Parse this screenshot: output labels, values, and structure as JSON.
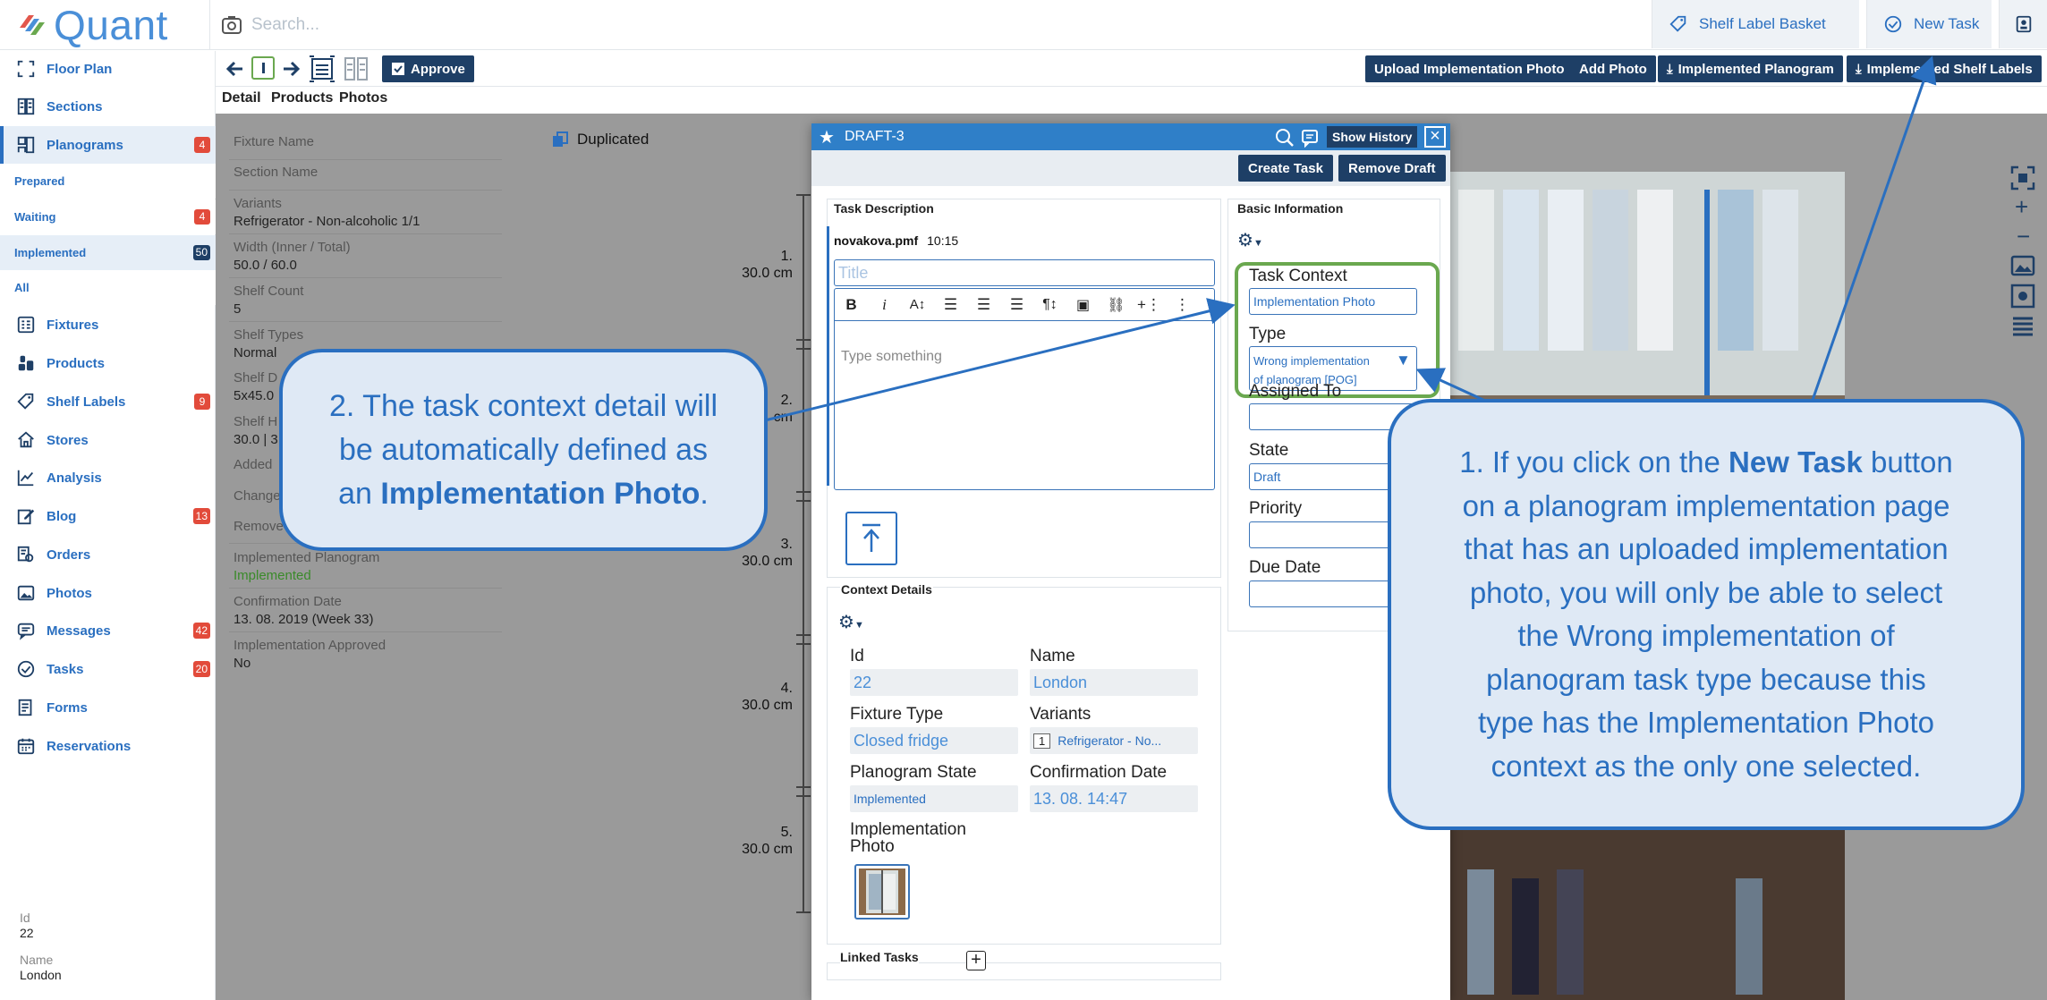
{
  "app": {
    "name": "Quant"
  },
  "search": {
    "placeholder": "Search..."
  },
  "top_buttons": {
    "shelf_label_basket": "Shelf Label Basket",
    "new_task": "New Task"
  },
  "sidebar": {
    "items": [
      {
        "label": "Floor Plan",
        "icon": "floor-plan-icon"
      },
      {
        "label": "Sections",
        "icon": "sections-icon"
      },
      {
        "label": "Planograms",
        "icon": "planograms-icon",
        "badge": "4"
      },
      {
        "label": "Fixtures",
        "icon": "fixtures-icon"
      },
      {
        "label": "Products",
        "icon": "products-icon"
      },
      {
        "label": "Shelf Labels",
        "icon": "tag-icon",
        "badge": "9"
      },
      {
        "label": "Stores",
        "icon": "store-icon"
      },
      {
        "label": "Analysis",
        "icon": "chart-icon"
      },
      {
        "label": "Blog",
        "icon": "edit-icon",
        "badge": "13"
      },
      {
        "label": "Orders",
        "icon": "orders-icon"
      },
      {
        "label": "Photos",
        "icon": "photo-icon"
      },
      {
        "label": "Messages",
        "icon": "message-icon",
        "badge": "42"
      },
      {
        "label": "Tasks",
        "icon": "check-icon",
        "badge": "20"
      },
      {
        "label": "Forms",
        "icon": "forms-icon"
      },
      {
        "label": "Reservations",
        "icon": "calendar-icon"
      }
    ],
    "submenu": [
      {
        "label": "Prepared"
      },
      {
        "label": "Waiting",
        "badge": "4"
      },
      {
        "label": "Implemented",
        "badge": "50"
      },
      {
        "label": "All"
      }
    ],
    "info": {
      "id_label": "Id",
      "id_value": "22",
      "name_label": "Name",
      "name_value": "London"
    }
  },
  "toolbar": {
    "approve": "Approve",
    "upload_photo": "Upload Implementation Photo",
    "add_photo": "Add Photo",
    "implemented_planogram": "Implemented Planogram",
    "implemented_shelf_labels": "Implemented Shelf Labels"
  },
  "tabs": [
    "Detail",
    "Products",
    "Photos"
  ],
  "detail": {
    "fixture_name": "Fixture Name",
    "section_name": "Section Name",
    "variants_label": "Variants",
    "variants_value": "Refrigerator - Non-alcoholic 1/1",
    "width_label": "Width (Inner / Total)",
    "width_value": "50.0 / 60.0",
    "shelf_count_label": "Shelf Count",
    "shelf_count_value": "5",
    "shelf_types_label": "Shelf Types",
    "shelf_types_value": "Normal",
    "shelf_d_label": "Shelf D",
    "shelf_d_value": "5x45.0",
    "shelf_h_label": "Shelf H",
    "shelf_h_value": "30.0 | 3",
    "added_label": "Added",
    "changed_label": "Change",
    "removed_label": "Remove",
    "impl_pog_label": "Implemented Planogram",
    "impl_pog_value": "Implemented",
    "confirmation_label": "Confirmation Date",
    "confirmation_value": "13. 08. 2019 (Week 33)",
    "approved_label": "Implementation Approved",
    "approved_value": "No",
    "duplicated": "Duplicated"
  },
  "shelves": [
    {
      "num": "1.",
      "height": "30.0 cm"
    },
    {
      "num": "2.",
      "height": "cm"
    },
    {
      "num": "3.",
      "height": "30.0 cm"
    },
    {
      "num": "4.",
      "height": "30.0 cm"
    },
    {
      "num": "5.",
      "height": "30.0 cm"
    }
  ],
  "modal": {
    "title": "DRAFT-3",
    "show_history": "Show History",
    "create_task": "Create Task",
    "remove_draft": "Remove Draft",
    "task_description": "Task Description",
    "author": "novakova.pmf",
    "time": "10:15",
    "title_placeholder": "Title",
    "body_placeholder": "Type something",
    "basic_information": "Basic Information",
    "task_context_label": "Task Context",
    "task_context_value": "Implementation Photo",
    "type_label": "Type",
    "type_value_line1": "Wrong implementation",
    "type_value_line2": "of planogram [POG]",
    "assigned_label": "Assigned To",
    "state_label": "State",
    "state_value": "Draft",
    "priority_label": "Priority",
    "due_date_label": "Due Date",
    "context_details": "Context Details",
    "id_label": "Id",
    "id_value": "22",
    "name_label": "Name",
    "name_value": "London",
    "fixture_type_label": "Fixture Type",
    "fixture_type_value": "Closed fridge",
    "variants_label": "Variants",
    "variants_count": "1",
    "variants_value": "Refrigerator - No...",
    "pog_state_label": "Planogram State",
    "pog_state_value": "Implemented",
    "conf_date_label": "Confirmation Date",
    "conf_date_value": "13. 08. 14:47",
    "impl_photo_label_1": "Implementation",
    "impl_photo_label_2": "Photo",
    "linked_tasks": "Linked Tasks"
  },
  "callouts": {
    "c2_line1": "2. The task context detail will",
    "c2_line2": "be automatically defined as",
    "c2_line3a": "an ",
    "c2_line3b": "Implementation Photo",
    "c2_line3c": ".",
    "c1_line1a": "1. If you click on the ",
    "c1_line1b": "New Task",
    "c1_line1c": " button",
    "c1_line2": "on a planogram implementation page",
    "c1_line3": "that has an uploaded implementation",
    "c1_line4": "photo, you will only be able to select",
    "c1_line5": "the Wrong implementation of",
    "c1_line6": "planogram task type because this",
    "c1_line7": "type has the Implementation Photo",
    "c1_line8": "context as the only one selected."
  },
  "colors": {
    "accent": "#2a6fc0",
    "navy": "#1e3f66",
    "badge": "#e24b3b",
    "highlight": "#6aa84f"
  }
}
